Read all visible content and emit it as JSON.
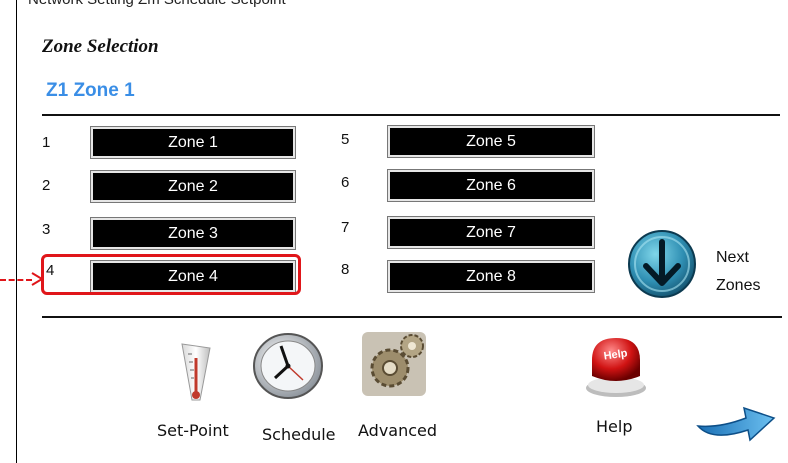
{
  "header": {
    "cut_title": "Network Setting Zm Schedule Setpoint",
    "section_title": "Zone Selection",
    "current_zone": "Z1 Zone 1"
  },
  "zones": [
    {
      "num": "1",
      "label": "Zone 1"
    },
    {
      "num": "2",
      "label": "Zone 2"
    },
    {
      "num": "3",
      "label": "Zone 3"
    },
    {
      "num": "4",
      "label": "Zone 4"
    },
    {
      "num": "5",
      "label": "Zone 5"
    },
    {
      "num": "6",
      "label": "Zone 6"
    },
    {
      "num": "7",
      "label": "Zone 7"
    },
    {
      "num": "8",
      "label": "Zone 8"
    }
  ],
  "next": {
    "line1": "Next",
    "line2": "Zones"
  },
  "toolbar": {
    "setpoint": "Set-Point",
    "schedule": "Schedule",
    "advanced": "Advanced",
    "help": "Help"
  },
  "colors": {
    "accent_blue": "#3a8ee6",
    "highlight_red": "#e0161a",
    "button_bg": "#000000"
  }
}
